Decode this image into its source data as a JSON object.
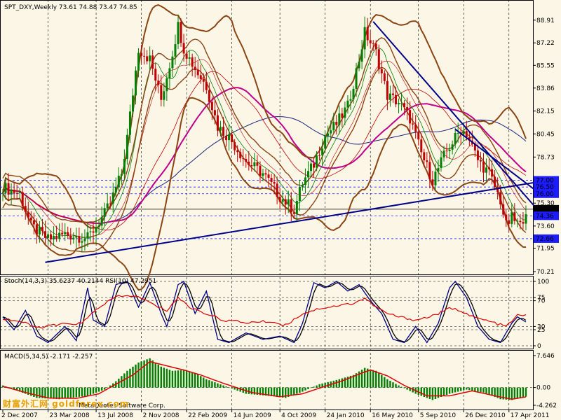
{
  "header": {
    "main_title": "SPT_DXY,Weekly  73.61 74.88 73.47 74.85",
    "stoch_title": "Stoch(14,3,3) 35.6237 40.2144  RSI(10) 47.2951",
    "macd_title": "MACD(5,34,5) -2.171 -2.257",
    "watermark": "财富外汇网 goldforex.com",
    "copyright": "MetaQuotes Software Corp."
  },
  "colors": {
    "background": "#fcf6e6",
    "grid": "#000000",
    "bull_candle": "#008000",
    "bear_candle": "#c00000",
    "bollinger": "#8b4513",
    "ma_long": "#1a237e",
    "ma_mid": "#c0008c",
    "ma_red": "#c00000",
    "trendline": "#00008b",
    "stoch_main": "#000080",
    "stoch_signal": "#000000",
    "rsi": "#e00000",
    "macd_hist": "#008000",
    "macd_signal": "#e00000"
  },
  "chart_data": [
    {
      "type": "candlestick",
      "title": "SPT_DXY,Weekly",
      "symbol": "SPT_DXY",
      "timeframe": "Weekly",
      "last_bar": {
        "open": 73.61,
        "high": 74.88,
        "low": 73.47,
        "close": 74.85
      },
      "ylim": [
        70.21,
        90.2
      ],
      "y_ticks": [
        "88.91",
        "87.22",
        "85.55",
        "83.86",
        "82.15",
        "80.45",
        "78.73",
        "77.00",
        "76.50",
        "76.00",
        "75.30",
        "74.85",
        "74.36",
        "73.60",
        "72.66",
        "71.95",
        "70.21"
      ],
      "highlighted_levels": [
        77.0,
        76.5,
        76.0,
        74.36,
        72.66
      ],
      "current_price": 74.85,
      "x_tick_labels": [
        "2 Dec 2007",
        "23 Mar 2008",
        "13 Jul 2008",
        "2 Nov 2008",
        "22 Feb 2009",
        "14 Jun 2009",
        "4 Oct 2009",
        "24 Jan 2010",
        "16 May 2010",
        "5 Sep 2010",
        "26 Dec 2010",
        "17 Apr 2011"
      ],
      "price_path": [
        [
          0,
          76.5
        ],
        [
          6,
          76.0
        ],
        [
          10,
          73.6
        ],
        [
          16,
          72.6
        ],
        [
          22,
          73.0
        ],
        [
          30,
          72.7
        ],
        [
          36,
          74.5
        ],
        [
          38,
          75.3
        ],
        [
          42,
          77.5
        ],
        [
          44,
          80.2
        ],
        [
          46,
          83.5
        ],
        [
          48,
          86.8
        ],
        [
          52,
          86.0
        ],
        [
          56,
          83.0
        ],
        [
          60,
          86.5
        ],
        [
          62,
          88.5
        ],
        [
          64,
          86.8
        ],
        [
          68,
          85.3
        ],
        [
          72,
          84.0
        ],
        [
          76,
          81.0
        ],
        [
          80,
          80.2
        ],
        [
          86,
          78.4
        ],
        [
          92,
          77.5
        ],
        [
          98,
          75.8
        ],
        [
          103,
          74.8
        ],
        [
          106,
          76.8
        ],
        [
          110,
          78.2
        ],
        [
          114,
          80.3
        ],
        [
          118,
          81.2
        ],
        [
          122,
          82.5
        ],
        [
          126,
          86.0
        ],
        [
          128,
          88.0
        ],
        [
          132,
          86.5
        ],
        [
          136,
          83.3
        ],
        [
          140,
          82.8
        ],
        [
          144,
          81.6
        ],
        [
          148,
          79.0
        ],
        [
          152,
          77.0
        ],
        [
          156,
          78.8
        ],
        [
          158,
          79.5
        ],
        [
          162,
          80.8
        ],
        [
          164,
          80.5
        ],
        [
          168,
          78.5
        ],
        [
          172,
          77.5
        ],
        [
          176,
          75.5
        ],
        [
          178,
          73.6
        ],
        [
          180,
          74.2
        ],
        [
          183,
          73.6
        ],
        [
          185,
          74.85
        ]
      ],
      "trendlines": [
        {
          "from": [
            15,
            70.9
          ],
          "to": [
            190,
            76.9
          ]
        },
        {
          "from": [
            131,
            88.8
          ],
          "to": [
            190,
            74.6
          ]
        },
        {
          "from": [
            160,
            80.8
          ],
          "to": [
            190,
            76.0
          ]
        }
      ],
      "series": [
        {
          "name": "Bollinger upper",
          "values_desc": "upper envelope"
        },
        {
          "name": "Bollinger lower",
          "values_desc": "lower envelope"
        },
        {
          "name": "MA long",
          "values_desc": "slow moving average"
        },
        {
          "name": "MA mid",
          "values_desc": "medium moving average"
        },
        {
          "name": "MA fast",
          "values_desc": "fast moving averages"
        }
      ]
    },
    {
      "type": "line",
      "title": "Stoch(14,3,3) 35.6237 40.2144  RSI(10) 47.2951",
      "stoch_main_last": 35.6237,
      "stoch_signal_last": 40.2144,
      "rsi_last": 47.2951,
      "ylim": [
        0,
        100
      ],
      "y_ticks": [
        "100",
        "75",
        "70",
        "30",
        "25",
        "0"
      ],
      "stoch_path": [
        [
          0,
          45
        ],
        [
          4,
          25
        ],
        [
          8,
          55
        ],
        [
          12,
          15
        ],
        [
          16,
          5
        ],
        [
          22,
          30
        ],
        [
          26,
          8
        ],
        [
          30,
          90
        ],
        [
          32,
          40
        ],
        [
          36,
          30
        ],
        [
          40,
          95
        ],
        [
          44,
          100
        ],
        [
          48,
          60
        ],
        [
          52,
          98
        ],
        [
          56,
          50
        ],
        [
          58,
          30
        ],
        [
          62,
          95
        ],
        [
          64,
          100
        ],
        [
          68,
          50
        ],
        [
          72,
          85
        ],
        [
          76,
          10
        ],
        [
          80,
          5
        ],
        [
          86,
          20
        ],
        [
          92,
          10
        ],
        [
          98,
          15
        ],
        [
          103,
          5
        ],
        [
          106,
          35
        ],
        [
          110,
          98
        ],
        [
          114,
          90
        ],
        [
          118,
          100
        ],
        [
          122,
          85
        ],
        [
          126,
          95
        ],
        [
          130,
          70
        ],
        [
          134,
          50
        ],
        [
          138,
          10
        ],
        [
          142,
          5
        ],
        [
          146,
          30
        ],
        [
          150,
          5
        ],
        [
          154,
          35
        ],
        [
          158,
          90
        ],
        [
          160,
          100
        ],
        [
          164,
          75
        ],
        [
          168,
          30
        ],
        [
          172,
          10
        ],
        [
          176,
          5
        ],
        [
          180,
          35
        ],
        [
          182,
          45
        ],
        [
          185,
          37
        ]
      ],
      "rsi_path": [
        [
          0,
          42
        ],
        [
          6,
          38
        ],
        [
          12,
          28
        ],
        [
          20,
          33
        ],
        [
          28,
          35
        ],
        [
          34,
          60
        ],
        [
          40,
          76
        ],
        [
          46,
          78
        ],
        [
          50,
          72
        ],
        [
          54,
          62
        ],
        [
          58,
          55
        ],
        [
          62,
          75
        ],
        [
          66,
          60
        ],
        [
          72,
          50
        ],
        [
          78,
          40
        ],
        [
          86,
          36
        ],
        [
          94,
          38
        ],
        [
          100,
          32
        ],
        [
          106,
          50
        ],
        [
          112,
          58
        ],
        [
          118,
          62
        ],
        [
          124,
          66
        ],
        [
          128,
          74
        ],
        [
          132,
          60
        ],
        [
          136,
          50
        ],
        [
          140,
          45
        ],
        [
          146,
          40
        ],
        [
          150,
          44
        ],
        [
          154,
          50
        ],
        [
          158,
          58
        ],
        [
          162,
          55
        ],
        [
          166,
          45
        ],
        [
          172,
          38
        ],
        [
          178,
          30
        ],
        [
          182,
          47
        ],
        [
          185,
          47
        ]
      ]
    },
    {
      "type": "bar",
      "title": "MACD(5,34,5) -2.171 -2.257",
      "macd_last": -2.171,
      "signal_last": -2.257,
      "ylim": [
        -4.262,
        7.646
      ],
      "y_ticks": [
        "7.646",
        "0.00",
        "-4.262"
      ],
      "hist_path": [
        [
          0,
          0.5
        ],
        [
          6,
          -1.0
        ],
        [
          12,
          -2.5
        ],
        [
          20,
          -2.8
        ],
        [
          30,
          -2.0
        ],
        [
          36,
          -0.5
        ],
        [
          40,
          1.5
        ],
        [
          44,
          4.0
        ],
        [
          48,
          6.0
        ],
        [
          52,
          7.0
        ],
        [
          56,
          5.0
        ],
        [
          60,
          4.0
        ],
        [
          64,
          4.2
        ],
        [
          68,
          3.5
        ],
        [
          72,
          2.0
        ],
        [
          78,
          0.5
        ],
        [
          86,
          -1.5
        ],
        [
          94,
          -2.0
        ],
        [
          100,
          -2.5
        ],
        [
          106,
          -1.0
        ],
        [
          112,
          0.8
        ],
        [
          118,
          1.8
        ],
        [
          124,
          3.0
        ],
        [
          128,
          4.7
        ],
        [
          132,
          4.0
        ],
        [
          136,
          2.0
        ],
        [
          140,
          0.5
        ],
        [
          146,
          -1.5
        ],
        [
          152,
          -3.0
        ],
        [
          158,
          -1.5
        ],
        [
          164,
          -0.5
        ],
        [
          170,
          -1.2
        ],
        [
          176,
          -2.8
        ],
        [
          180,
          -3.0
        ],
        [
          185,
          -2.2
        ]
      ],
      "signal_path": [
        [
          0,
          0.3
        ],
        [
          8,
          -1.2
        ],
        [
          16,
          -2.5
        ],
        [
          26,
          -2.6
        ],
        [
          34,
          -1.5
        ],
        [
          40,
          0.8
        ],
        [
          46,
          3.0
        ],
        [
          52,
          6.2
        ],
        [
          58,
          5.2
        ],
        [
          64,
          4.2
        ],
        [
          70,
          3.0
        ],
        [
          78,
          1.0
        ],
        [
          88,
          -1.2
        ],
        [
          98,
          -2.2
        ],
        [
          106,
          -1.5
        ],
        [
          114,
          0.3
        ],
        [
          120,
          1.6
        ],
        [
          126,
          3.2
        ],
        [
          130,
          4.2
        ],
        [
          136,
          2.8
        ],
        [
          142,
          0.5
        ],
        [
          150,
          -2.0
        ],
        [
          158,
          -2.0
        ],
        [
          166,
          -0.8
        ],
        [
          174,
          -2.0
        ],
        [
          180,
          -2.8
        ],
        [
          185,
          -2.257
        ]
      ]
    }
  ]
}
